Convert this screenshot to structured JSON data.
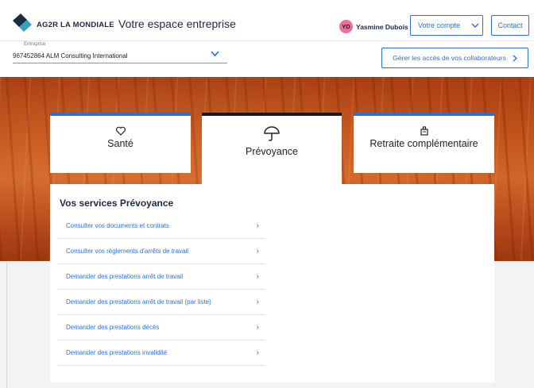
{
  "header": {
    "brand": "AG2R LA MONDIALE",
    "app_title": "Votre espace entreprise",
    "user": {
      "initials": "YD",
      "name": "Yasmine Dubois"
    },
    "account_button": "Votre compte",
    "contact_button": "Contact"
  },
  "enterprise": {
    "label": "Entreprise",
    "value": "967452864 ALM Consulting International"
  },
  "access_button": "Gérer les accès de vos collaborateurs",
  "cards": [
    {
      "label": "Santé",
      "icon": "heart-icon",
      "active": false
    },
    {
      "label": "Prévoyance",
      "icon": "umbrella-icon",
      "active": true
    },
    {
      "label": "Retraite complémentaire",
      "icon": "retirement-icon",
      "active": false
    }
  ],
  "services": {
    "title": "Vos services Prévoyance",
    "items": [
      "Consulter vos documents et contrats",
      "Consulter vos règlements d'arrêts de travail",
      "Demander des prestations arrêt de travail",
      "Demander des prestations arrêt de travail (par liste)",
      "Demander des prestations décès",
      "Demander des prestations invalidité"
    ]
  },
  "colors": {
    "accent": "#2d6fd6",
    "brand_dark": "#1c2a44",
    "avatar": "#ea6fa3",
    "hero": "#c4561c"
  }
}
